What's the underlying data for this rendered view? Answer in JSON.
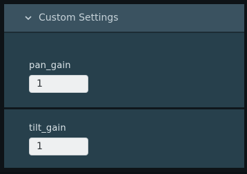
{
  "panel": {
    "title": "Custom Settings",
    "toggle_icon": "chevron-down-icon"
  },
  "fields": [
    {
      "label": "pan_gain",
      "value": "1"
    },
    {
      "label": "tilt_gain",
      "value": "1"
    }
  ]
}
